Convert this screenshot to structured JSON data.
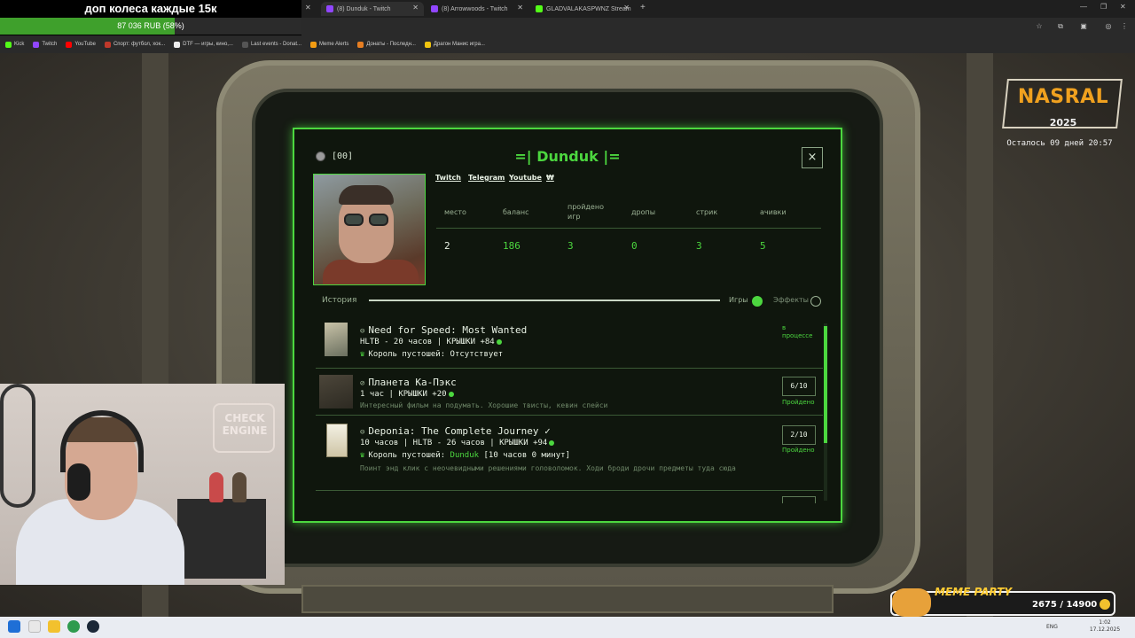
{
  "browser": {
    "tabs": [
      {
        "label": "(8) Dunduk - Twitch",
        "active": true
      },
      {
        "label": "(8) Arrowwoods - Twitch",
        "active": false
      },
      {
        "label": "GLADVALAKASPWNZ Stream",
        "active": false
      }
    ],
    "new_tab": "+",
    "bookmarks": [
      {
        "label": "Kick",
        "color": "#53fc18"
      },
      {
        "label": "Twitch",
        "color": "#9146ff"
      },
      {
        "label": "YouTube",
        "color": "#ff0000"
      },
      {
        "label": "Спорт: футбол, хок...",
        "color": "#c0392b"
      },
      {
        "label": "DTF — игры, кино,...",
        "color": "#eeeeee"
      },
      {
        "label": "Last events - Donat...",
        "color": "#333333"
      },
      {
        "label": "Meme Alerts",
        "color": "#f39c12"
      },
      {
        "label": "Донаты - Последн...",
        "color": "#e67e22"
      },
      {
        "label": "Драгон Манис игра...",
        "color": "#f1c40f"
      }
    ]
  },
  "donation": {
    "title": "доп колеса каждые 15к",
    "progress_text": "87 036 RUB (58%)",
    "progress_fraction": 0.58
  },
  "modal": {
    "coins": "[00]",
    "title": "Dunduk",
    "title_left": "=|",
    "title_right": "|=",
    "close": "×",
    "links": [
      "Twitch",
      "Telegram",
      "Youtube",
      "₩"
    ],
    "stats": [
      {
        "label": "место",
        "value": "2"
      },
      {
        "label": "баланс",
        "value": "186"
      },
      {
        "label": "пройдено\nигр",
        "value": "3"
      },
      {
        "label": "дропы",
        "value": "0"
      },
      {
        "label": "стрик",
        "value": "3"
      },
      {
        "label": "ачивки",
        "value": "5"
      }
    ],
    "history_label": "История",
    "toggle_games": "Игры",
    "toggle_effects": "Эффекты",
    "games": [
      {
        "title": "Need for Speed: Most Wanted",
        "meta": "HLTB - 20 часов | КРЫШКИ +84",
        "king_label": "Король пустошей:",
        "king_value": "Отсутствует",
        "status": "в\nпроцессе",
        "score": ""
      },
      {
        "title": "Планета Ка-Пэкс",
        "meta": "1 час | КРЫШКИ +20",
        "description": "Интересный фильм на подумать. Хорошие твисты, кевин спейси",
        "status": "Пройдено",
        "score": "6/10"
      },
      {
        "title": "Deponia: The Complete Journey",
        "meta": "10 часов | HLTB - 26 часов | КРЫШКИ +94",
        "king_label": "Король пустошей:",
        "king_value": "Dunduk",
        "king_extra": "[10 часов 0 минут]",
        "description": "Поинт энд клик с неочевидными решениями головоломок. Ходи броди дрочи предметы туда сюда",
        "status": "Пройдено",
        "score": "2/10"
      }
    ]
  },
  "overlay": {
    "logo": "NASRAL",
    "logo_year": "2025",
    "countdown": "Осталось 09 дней 20:57",
    "meme_title": "MEME PARTY",
    "meme_value": "2675 / 14900"
  },
  "webcam": {
    "sign": "CHECK\nENGINE"
  },
  "taskbar": {
    "lang": "ENG",
    "time": "1:02",
    "date": "17.12.2025"
  }
}
